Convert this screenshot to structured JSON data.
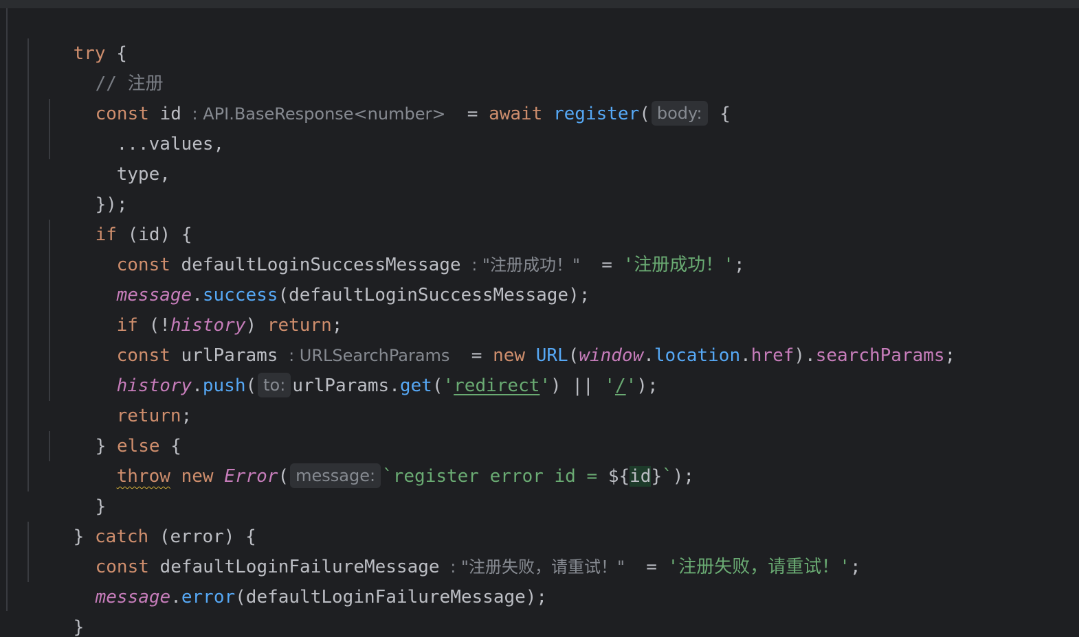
{
  "code": {
    "l1_try": "try",
    "l1_brace": " {",
    "l2_comment": "// 注册",
    "l3_const": "const",
    "l3_var": " id ",
    "l3_type_hint": ": API.BaseResponse<number>",
    "l3_eq": "  = ",
    "l3_await": "await",
    "l3_sp": " ",
    "l3_fn": "register",
    "l3_paren": "(",
    "l3_param_hint": "body:",
    "l3_brace": " {",
    "l4_text": "...values,",
    "l5_text": "type,",
    "l6_text": "});",
    "l7_if": "if",
    "l7_rest": " (id) {",
    "l8_const": "const",
    "l8_var": " defaultLoginSuccessMessage ",
    "l8_type_hint": ": \"注册成功！\"",
    "l8_eq": "  = ",
    "l8_str": "'注册成功！'",
    "l8_semi": ";",
    "l9_obj": "message",
    "l9_dot": ".",
    "l9_fn": "success",
    "l9_rest": "(defaultLoginSuccessMessage);",
    "l10_if": "if",
    "l10_open": " (!",
    "l10_obj": "history",
    "l10_close": ") ",
    "l10_return": "return",
    "l10_semi": ";",
    "l11_const": "const",
    "l11_var": " urlParams ",
    "l11_type_hint": ": URLSearchParams",
    "l11_eq": "  = ",
    "l11_new": "new",
    "l11_sp": " ",
    "l11_cls": "URL",
    "l11_paren": "(",
    "l11_window": "window",
    "l11_dot1": ".",
    "l11_location": "location",
    "l11_dot2": ".",
    "l11_href": "href",
    "l11_close": ").",
    "l11_search": "searchParams",
    "l11_semi": ";",
    "l12_obj": "history",
    "l12_dot": ".",
    "l12_fn": "push",
    "l12_paren": "(",
    "l12_param_hint": "to:",
    "l12_var": "urlParams.",
    "l12_get": "get",
    "l12_open": "(",
    "l12_q1": "'",
    "l12_redirect": "redirect",
    "l12_q2": "'",
    "l12_or": ") || ",
    "l12_q3": "'",
    "l12_slash": "/",
    "l12_q4": "'",
    "l12_end": ");",
    "l13_return": "return",
    "l13_semi": ";",
    "l14_brace": "} ",
    "l14_else": "else",
    "l14_open": " {",
    "l15_throw": "throw",
    "l15_sp": " ",
    "l15_new": "new",
    "l15_sp2": " ",
    "l15_cls": "Error",
    "l15_paren": "(",
    "l15_param_hint": "message:",
    "l15_tpl": "`register error id = ",
    "l15_open": "${",
    "l15_id": "id",
    "l15_close": "}",
    "l15_tick": "`",
    "l15_end": ");",
    "l16_text": "}",
    "l17_brace": "} ",
    "l17_catch": "catch",
    "l17_rest": " (error) {",
    "l18_const": "const",
    "l18_var": " defaultLoginFailureMessage ",
    "l18_type_hint": ": \"注册失败，请重试！\"",
    "l18_eq": "  = ",
    "l18_str": "'注册失败，请重试！'",
    "l18_semi": ";",
    "l19_obj": "message",
    "l19_dot": ".",
    "l19_fn": "error",
    "l19_rest": "(defaultLoginFailureMessage);",
    "l20_text": "}",
    "l21_text": "};"
  },
  "colors": {
    "background": "#1e1f22",
    "keyword": "#cf8e6d",
    "function": "#56a8f5",
    "global": "#c77dbb",
    "string": "#6aab73",
    "comment": "#7a7e85",
    "hint": "#868a91"
  }
}
